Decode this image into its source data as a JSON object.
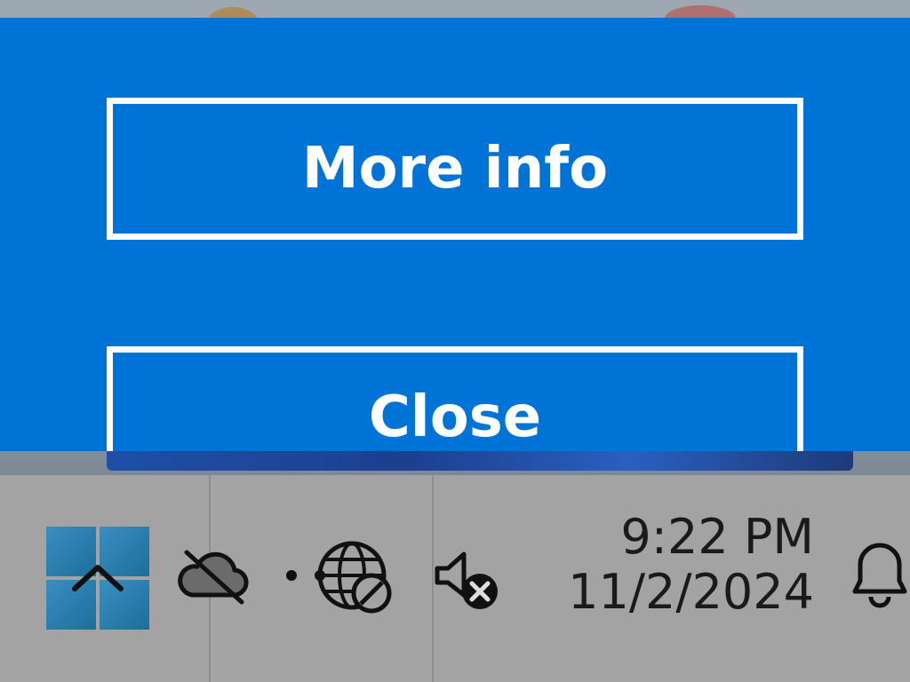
{
  "toast": {
    "background": "#0074d6",
    "more_info_label": "More info",
    "close_label": "Close"
  },
  "taskbar": {
    "tray": {
      "show_hidden_icon": "chevron-up-icon",
      "onedrive_icon": "cloud-offline-icon",
      "network_icon": "globe-no-internet-icon",
      "volume_icon": "speaker-muted-icon",
      "notifications_icon": "bell-icon"
    },
    "clock": {
      "time": "9:22 PM",
      "date": "11/2/2024"
    }
  }
}
